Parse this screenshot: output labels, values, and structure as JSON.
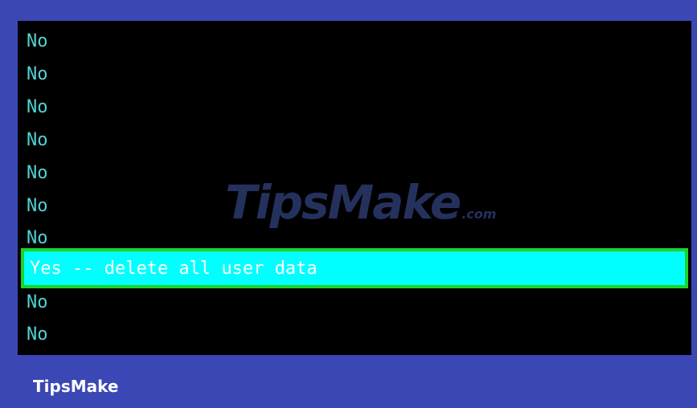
{
  "menu": {
    "items": [
      {
        "label": "No"
      },
      {
        "label": "No"
      },
      {
        "label": "No"
      },
      {
        "label": "No"
      },
      {
        "label": "No"
      },
      {
        "label": "No"
      },
      {
        "label": "No"
      },
      {
        "label": "Yes -- delete all user data",
        "selected": true
      },
      {
        "label": "No"
      },
      {
        "label": "No"
      }
    ]
  },
  "watermark": {
    "text": "TipsMake",
    "suffix": ".com"
  },
  "caption": "TipsMake",
  "colors": {
    "frame_background": "#3b47b5",
    "screen_background": "#000000",
    "item_text": "#4fd2d2",
    "selected_background": "#00ffff",
    "selected_border": "#1bd42a",
    "selected_text": "#ffffff"
  }
}
